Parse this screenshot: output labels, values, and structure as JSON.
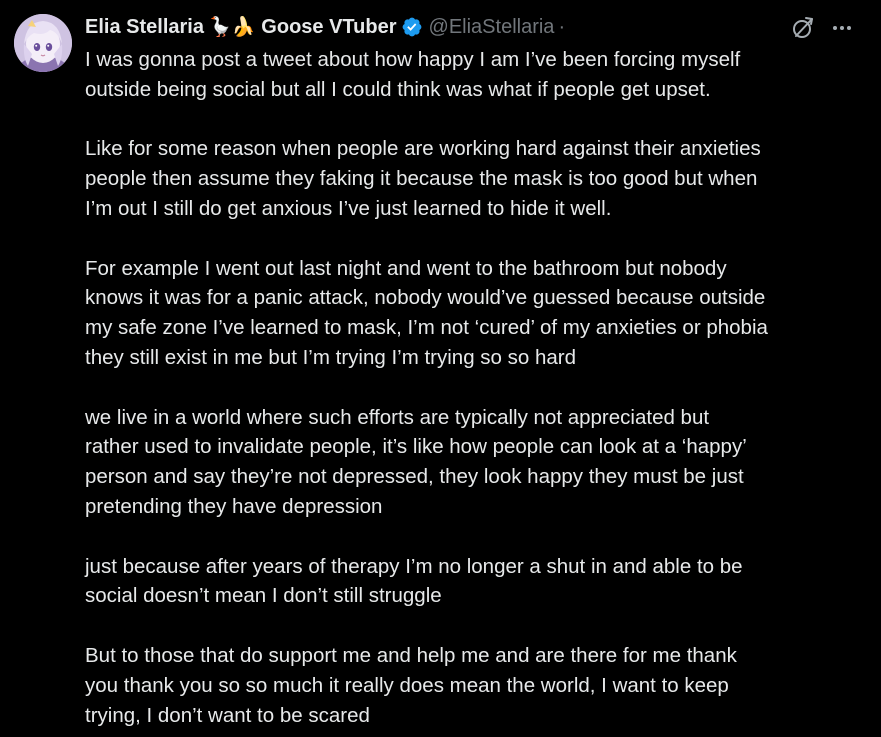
{
  "author": {
    "display_name": "Elia Stellaria",
    "name_emojis": "🪿🍌",
    "tag": "Goose VTuber",
    "handle": "@EliaStellaria",
    "separator": "·",
    "verified": true
  },
  "colors": {
    "background": "#000000",
    "text": "#e7e9ea",
    "secondary_text": "#71767b",
    "verified_badge": "#1d9bf0"
  },
  "icons": {
    "verified": "verified-badge-icon",
    "grok": "grok-icon",
    "more": "more-options-icon"
  },
  "tweet": {
    "paragraphs": [
      "I was gonna post a tweet about how happy I am I’ve been forcing myself\noutside being social but all I could think was what if people get upset.",
      "Like for some reason when people are working hard against their anxieties\npeople then assume they faking it because the mask is too good but when\nI’m out I still do get anxious I’ve just learned to hide it well.",
      "For example I went out last night and went to the bathroom but nobody\nknows it was for a panic attack, nobody would’ve guessed because outside\nmy safe zone I’ve learned to mask, I’m not ‘cured’ of my anxieties or phobia\nthey still exist in me but I’m trying I’m trying so so hard",
      "we live in a world where such efforts are typically not appreciated but\nrather used to invalidate people, it’s like how people can look at a ‘happy’\nperson and say they’re not depressed, they look happy they must be just\npretending they have depression",
      "just because after years of therapy I’m no longer a shut in and able to be\nsocial doesn’t mean I don’t still struggle",
      "But to those that do support me and help me and are there for me thank\nyou thank you so so much it really does mean the world, I want to keep\ntrying, I don’t want to be scared"
    ]
  }
}
